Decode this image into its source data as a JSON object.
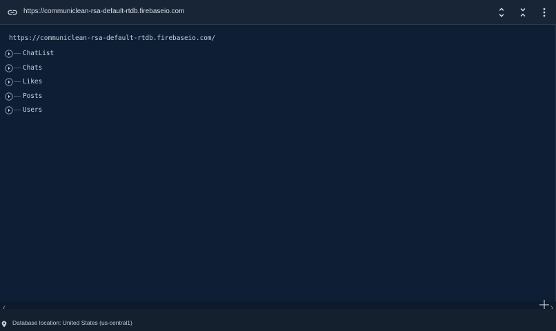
{
  "toolbar": {
    "url": "https://communiclean-rsa-default-rtdb.firebaseio.com",
    "link_icon": "link-icon",
    "expand_collapse_icon": "unfold-icon",
    "collapse_all_icon": "collapse-all-icon",
    "more_icon": "more-vert-icon"
  },
  "tree": {
    "root_url": "https://communiclean-rsa-default-rtdb.firebaseio.com/",
    "nodes": [
      {
        "label": "ChatList"
      },
      {
        "label": "Chats"
      },
      {
        "label": "Likes"
      },
      {
        "label": "Posts"
      },
      {
        "label": "Users"
      }
    ]
  },
  "footer": {
    "location_icon": "location-pin-icon",
    "location_text": "Database location: United States (us-central1)"
  },
  "colors": {
    "panel_bg": "#0e1f35",
    "toolbar_bg": "#182536",
    "text": "#c8d2dd"
  }
}
